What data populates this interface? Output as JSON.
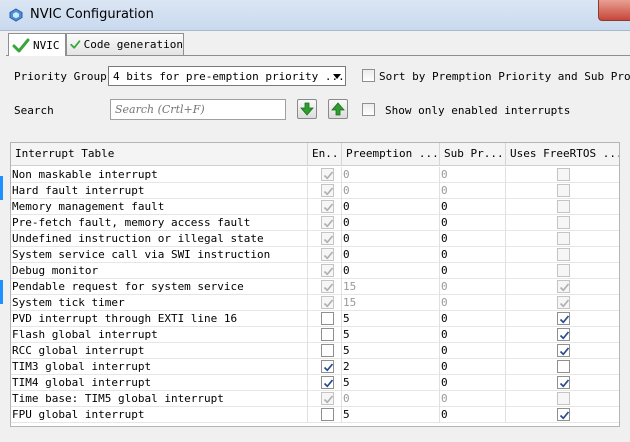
{
  "window": {
    "title": "NVIC Configuration"
  },
  "tabs": [
    {
      "label": "NVIC",
      "active": true
    },
    {
      "label": "Code generation",
      "active": false
    }
  ],
  "controls": {
    "priority_group_label": "Priority Group",
    "priority_group_value": "4 bits for pre-emption priority ...",
    "sort_label": "Sort by Premption Priority and Sub Prority",
    "search_label": "Search",
    "search_placeholder": "Search (Crtl+F)",
    "show_enabled_label": "Show only enabled interrupts"
  },
  "table": {
    "headers": [
      "Interrupt Table",
      "En...",
      "Preemption ...",
      "Sub Pr...",
      "Uses FreeRTOS ..."
    ],
    "rows": [
      {
        "name": "Non maskable interrupt",
        "enabled": true,
        "enabled_editable": false,
        "pre": "0",
        "pre_editable": false,
        "sub": "0",
        "sub_editable": false,
        "rtos": false,
        "rtos_editable": false
      },
      {
        "name": "Hard fault interrupt",
        "enabled": true,
        "enabled_editable": false,
        "pre": "0",
        "pre_editable": false,
        "sub": "0",
        "sub_editable": false,
        "rtos": false,
        "rtos_editable": false
      },
      {
        "name": "Memory management fault",
        "enabled": true,
        "enabled_editable": false,
        "pre": "0",
        "pre_editable": true,
        "sub": "0",
        "sub_editable": true,
        "rtos": false,
        "rtos_editable": false
      },
      {
        "name": "Pre-fetch fault, memory access fault",
        "enabled": true,
        "enabled_editable": false,
        "pre": "0",
        "pre_editable": true,
        "sub": "0",
        "sub_editable": true,
        "rtos": false,
        "rtos_editable": false
      },
      {
        "name": "Undefined instruction or illegal state",
        "enabled": true,
        "enabled_editable": false,
        "pre": "0",
        "pre_editable": true,
        "sub": "0",
        "sub_editable": true,
        "rtos": false,
        "rtos_editable": false
      },
      {
        "name": "System service call via SWI instruction",
        "enabled": true,
        "enabled_editable": false,
        "pre": "0",
        "pre_editable": true,
        "sub": "0",
        "sub_editable": true,
        "rtos": false,
        "rtos_editable": false
      },
      {
        "name": "Debug monitor",
        "enabled": true,
        "enabled_editable": false,
        "pre": "0",
        "pre_editable": true,
        "sub": "0",
        "sub_editable": true,
        "rtos": false,
        "rtos_editable": false
      },
      {
        "name": "Pendable request for system service",
        "enabled": true,
        "enabled_editable": false,
        "pre": "15",
        "pre_editable": false,
        "sub": "0",
        "sub_editable": false,
        "rtos": true,
        "rtos_editable": false
      },
      {
        "name": "System tick timer",
        "enabled": true,
        "enabled_editable": false,
        "pre": "15",
        "pre_editable": false,
        "sub": "0",
        "sub_editable": false,
        "rtos": true,
        "rtos_editable": false
      },
      {
        "name": "PVD interrupt through EXTI line 16",
        "enabled": false,
        "enabled_editable": true,
        "pre": "5",
        "pre_editable": true,
        "sub": "0",
        "sub_editable": true,
        "rtos": true,
        "rtos_editable": true
      },
      {
        "name": "Flash global interrupt",
        "enabled": false,
        "enabled_editable": true,
        "pre": "5",
        "pre_editable": true,
        "sub": "0",
        "sub_editable": true,
        "rtos": true,
        "rtos_editable": true
      },
      {
        "name": "RCC global interrupt",
        "enabled": false,
        "enabled_editable": true,
        "pre": "5",
        "pre_editable": true,
        "sub": "0",
        "sub_editable": true,
        "rtos": true,
        "rtos_editable": true
      },
      {
        "name": "TIM3 global interrupt",
        "enabled": true,
        "enabled_editable": true,
        "pre": "2",
        "pre_editable": true,
        "sub": "0",
        "sub_editable": true,
        "rtos": false,
        "rtos_editable": true
      },
      {
        "name": "TIM4 global interrupt",
        "enabled": true,
        "enabled_editable": true,
        "pre": "5",
        "pre_editable": true,
        "sub": "0",
        "sub_editable": true,
        "rtos": true,
        "rtos_editable": true
      },
      {
        "name": "Time base: TIM5 global interrupt",
        "enabled": true,
        "enabled_editable": false,
        "pre": "0",
        "pre_editable": false,
        "sub": "0",
        "sub_editable": false,
        "rtos": false,
        "rtos_editable": false
      },
      {
        "name": "FPU global interrupt",
        "enabled": false,
        "enabled_editable": true,
        "pre": "5",
        "pre_editable": true,
        "sub": "0",
        "sub_editable": true,
        "rtos": true,
        "rtos_editable": true
      }
    ]
  },
  "icons": {
    "app": "chip-icon",
    "tab_check": "green-check-icon",
    "find_next": "arrow-down-icon",
    "find_prev": "arrow-up-icon"
  },
  "colors": {
    "check_green": "#3aa63a",
    "nav_green": "#2e9e2e",
    "accent_blue": "#1e90ff"
  }
}
